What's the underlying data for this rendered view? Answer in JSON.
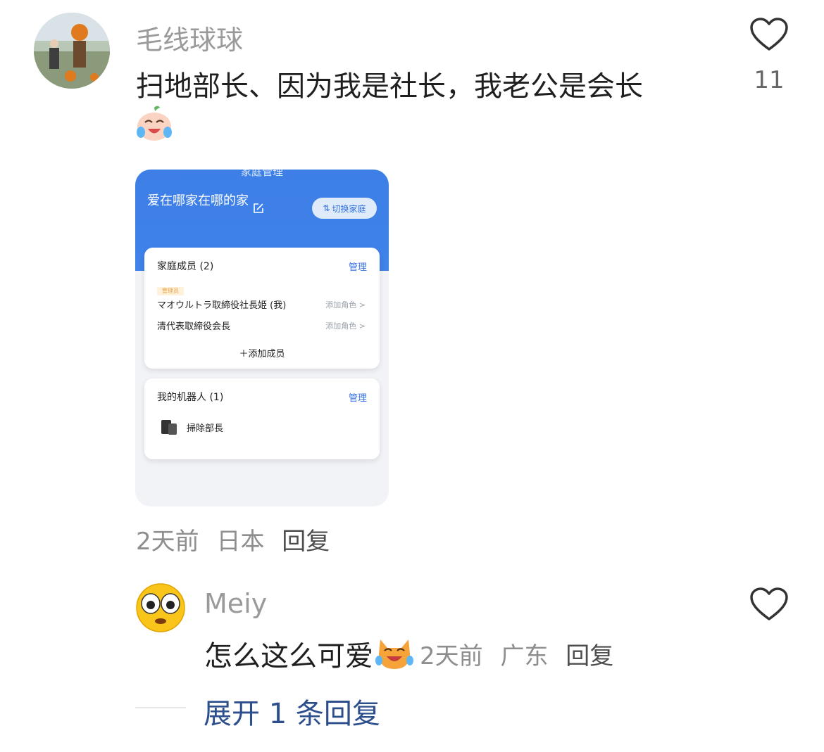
{
  "comment1": {
    "username": "毛线球球",
    "text": "扫地部长、因为我是社长，我老公是会长",
    "emoji_icon": "crying-laughing-face-icon",
    "like_count": "11",
    "time": "2天前",
    "location": "日本",
    "reply_label": "回复",
    "screenshot": {
      "top_title": "家庭管理",
      "family_name": "爱在哪家在哪的家",
      "switch_label": "切换家庭",
      "members_card": {
        "title": "家庭成员 (2)",
        "manage_label": "管理",
        "admin_tag": "管理员",
        "members": [
          {
            "name": "マオウルトラ取締役社長姫 (我)",
            "action": "添加角色 >"
          },
          {
            "name": "清代表取締役会長",
            "action": "添加角色 >"
          }
        ],
        "add_member_label": "添加成员"
      },
      "robots_card": {
        "title": "我的机器人 (1)",
        "manage_label": "管理",
        "robot_name": "掃除部長"
      }
    }
  },
  "comment2": {
    "username": "Meiy",
    "text": "怎么这么可爱",
    "emoji_icon": "laughing-cat-icon",
    "time": "2天前",
    "location": "广东",
    "reply_label": "回复"
  },
  "expand_replies": "展开 1 条回复",
  "colors": {
    "username": "#9a9a9a",
    "meta": "#8e8e8e",
    "link": "#2c4f8c",
    "app_blue": "#3f82ea"
  }
}
